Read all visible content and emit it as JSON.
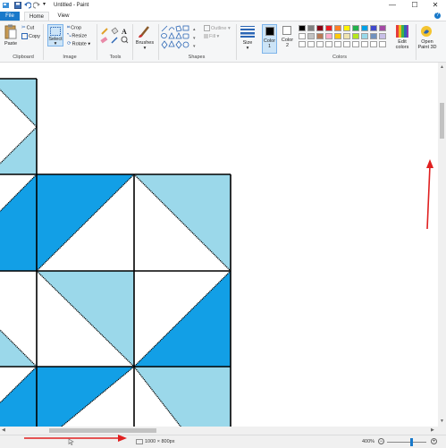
{
  "window": {
    "title": "Untitled - Paint",
    "minimize": "—",
    "maximize": "☐",
    "close": "✕"
  },
  "tabs": [
    {
      "label": "File"
    },
    {
      "label": "Home"
    },
    {
      "label": "View"
    }
  ],
  "help": "?",
  "ribbon": {
    "clipboard": {
      "paste": "Paste",
      "cut": "Cut",
      "copy": "Copy",
      "group": "Clipboard"
    },
    "image": {
      "select": "Select",
      "crop": "Crop",
      "resize": "Resize",
      "rotate": "Rotate",
      "group": "Image"
    },
    "tools": {
      "group": "Tools"
    },
    "brushes": {
      "label": "Brushes"
    },
    "shapes": {
      "outline": "Outline",
      "fill": "Fill",
      "group": "Shapes"
    },
    "size": {
      "label": "Size"
    },
    "colors": {
      "color1": "Color 1",
      "color1_short": "1",
      "color2": "Color 2",
      "color2_short": "2",
      "edit": "Edit colors",
      "group": "Colors",
      "row1": [
        "#000000",
        "#7f7f7f",
        "#880015",
        "#ed1c24",
        "#ff7f27",
        "#fff200",
        "#22b14c",
        "#00a2e8",
        "#3f48cc",
        "#a349a4"
      ],
      "row2": [
        "#ffffff",
        "#c3c3c3",
        "#b97a57",
        "#ffaec9",
        "#ffc90e",
        "#efe4b0",
        "#b5e61d",
        "#99d9ea",
        "#7092be",
        "#c8bfe7"
      ],
      "row3": [
        "#ffffff",
        "#ffffff",
        "#ffffff",
        "#ffffff",
        "#ffffff",
        "#ffffff",
        "#ffffff",
        "#ffffff",
        "#ffffff",
        "#ffffff"
      ]
    },
    "paint3d": "Open Paint 3D"
  },
  "canvas": {
    "dark_blue": "#129fe6",
    "light_blue": "#9bd8ea",
    "white": "#ffffff",
    "line": "#000000"
  },
  "status": {
    "dimensions": "1000 × 800px",
    "zoom": "400%"
  }
}
